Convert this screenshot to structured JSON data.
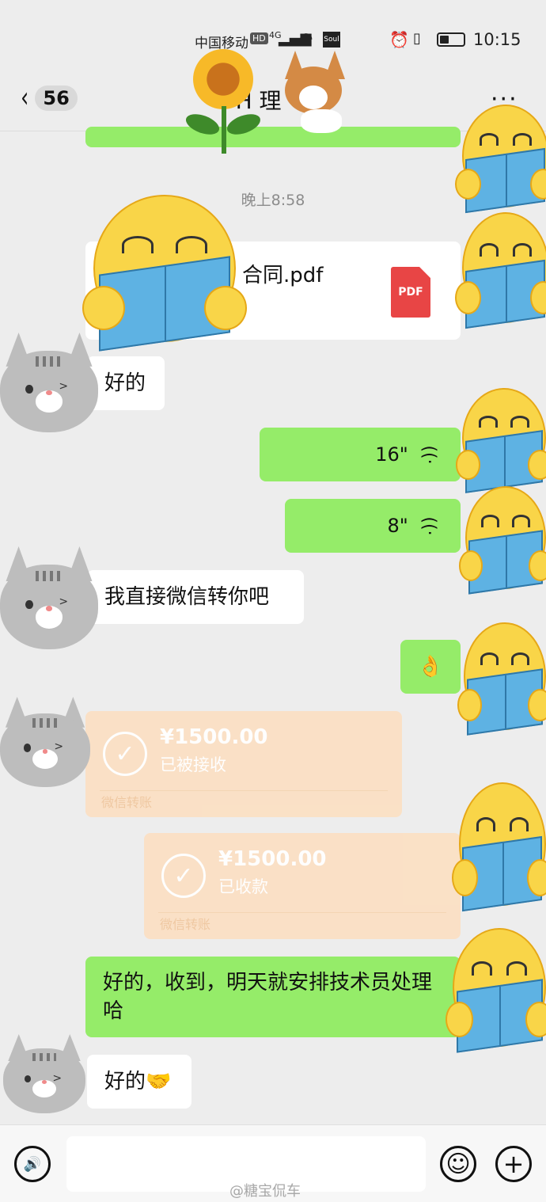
{
  "status_bar": {
    "carrier": "中国移动",
    "hd": "HD",
    "network": "4G",
    "app_badge": "Soul",
    "time": "10:15"
  },
  "nav": {
    "back_symbol": "‹",
    "unread_count": "56",
    "title": "H   理   一",
    "more_symbol": "···"
  },
  "messages": {
    "timestamp": "晚上8:58",
    "file": {
      "name": "合同.pdf",
      "icon_label": "PDF"
    },
    "reply_ok_1": "好的",
    "voice_1": {
      "duration": "16\"",
      "icon": "voice-wave-icon"
    },
    "voice_2": {
      "duration": "8\"",
      "icon": "voice-wave-icon"
    },
    "reply_transfer": "我直接微信转你吧",
    "ok_emoji": "👌",
    "transfer_1": {
      "amount": "¥1500.00",
      "status": "已被接收",
      "label": "微信转账"
    },
    "transfer_2": {
      "amount": "¥1500.00",
      "status": "已收款",
      "label": "微信转账"
    },
    "confirm": "好的，收到，明天就安排技术员处理哈",
    "reply_ok_2": "好的🤝"
  },
  "input_bar": {
    "voice_symbol": "🔊",
    "emoji_symbol": "☺",
    "plus_symbol": "+",
    "placeholder": ""
  },
  "watermark": "@糖宝侃车",
  "colors": {
    "sent_bubble": "#95ec69",
    "received_bubble": "#ffffff",
    "transfer_card": "#fbe0c4",
    "background": "#ededed"
  }
}
